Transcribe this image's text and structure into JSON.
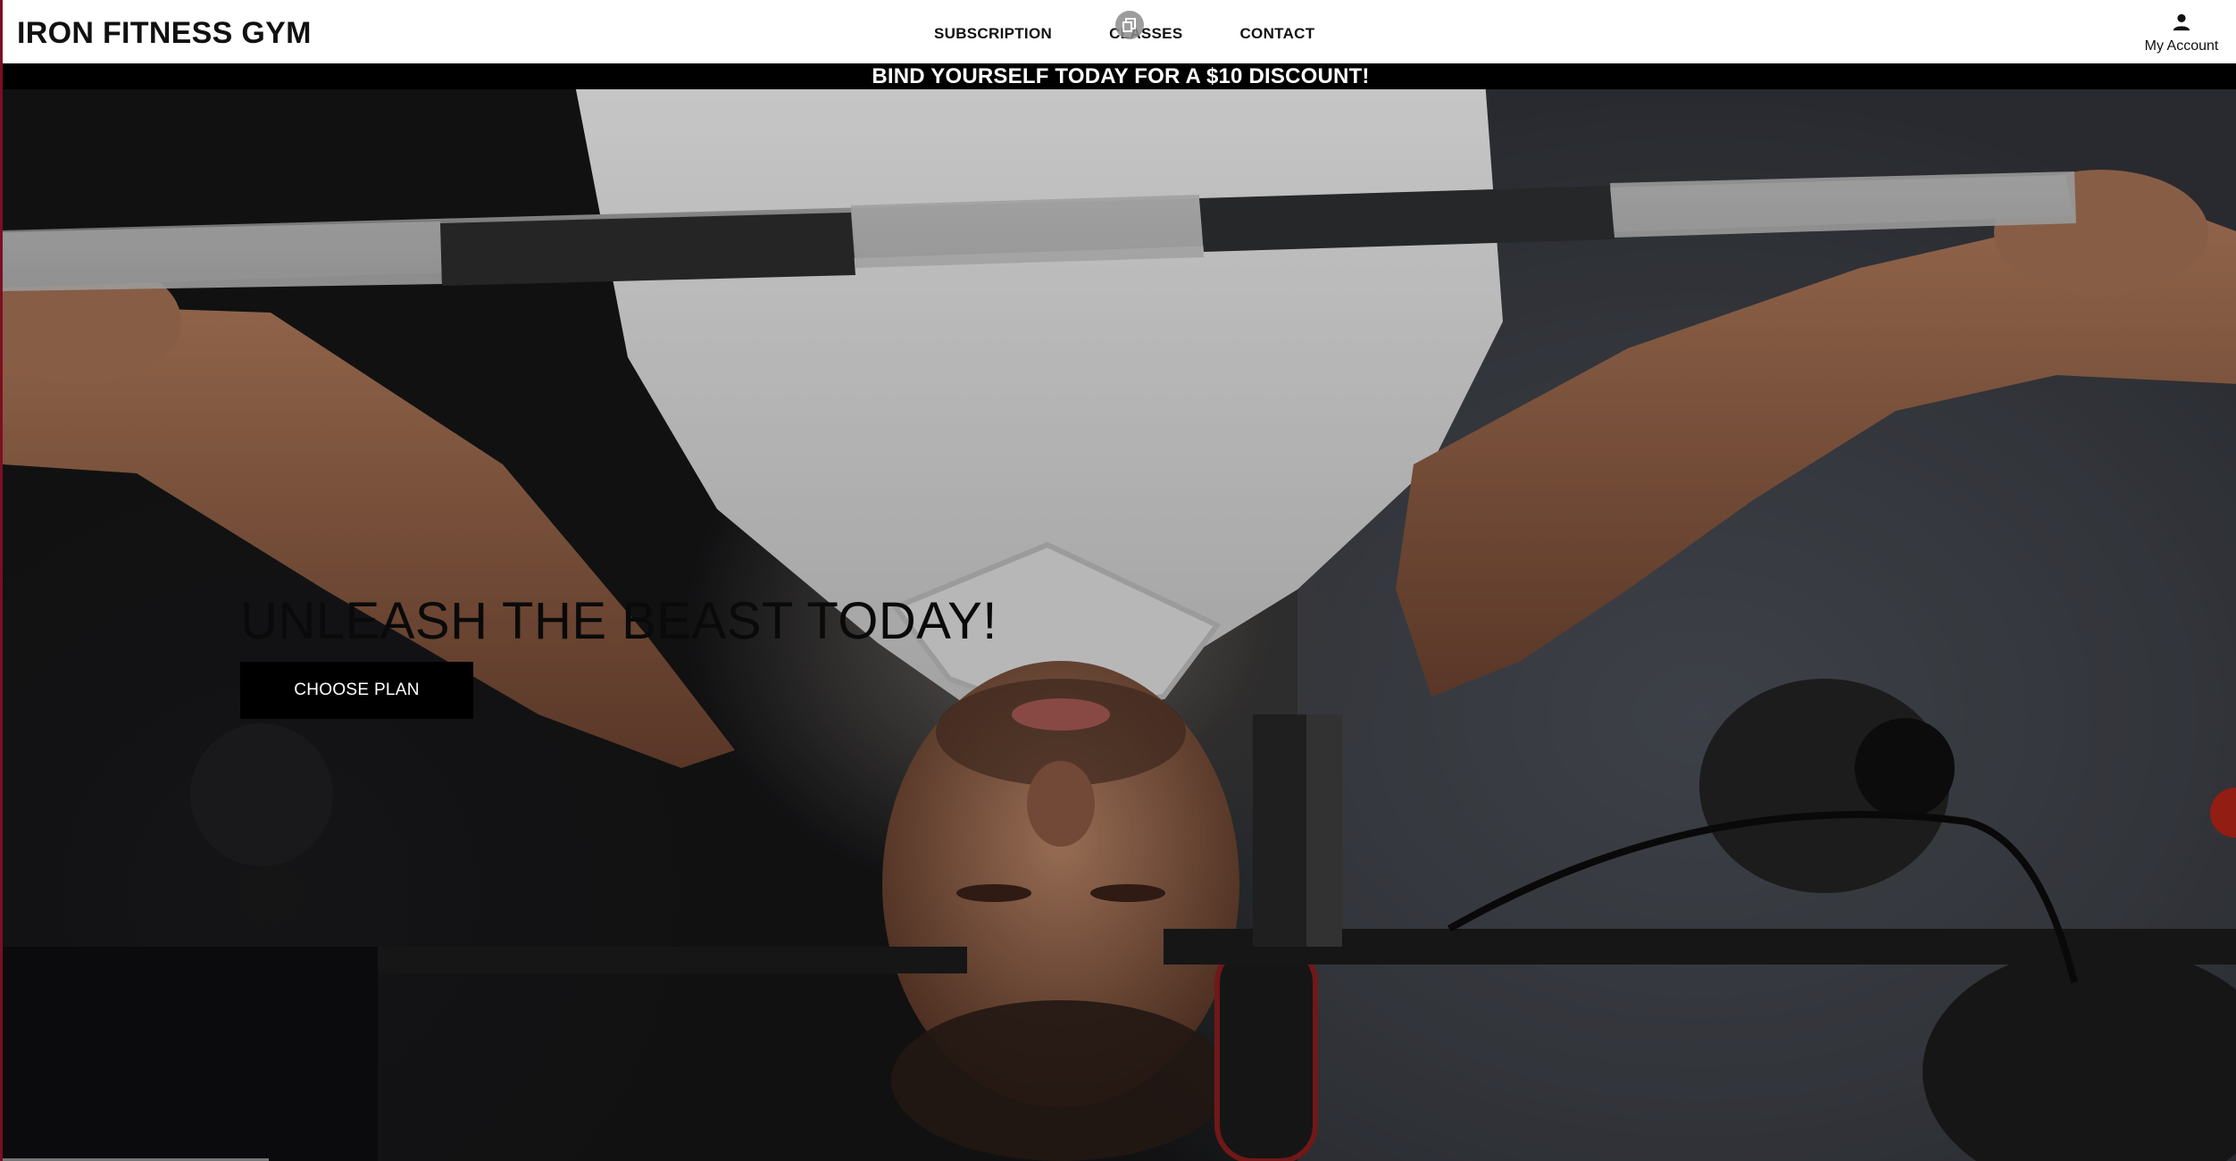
{
  "header": {
    "brand": "IRON FITNESS GYM",
    "nav": {
      "subscription": "SUBSCRIPTION",
      "classes": "CLASSES",
      "contact": "CONTACT"
    },
    "account": {
      "icon": "user-icon",
      "label": "My Account"
    }
  },
  "promo": {
    "text": "BIND YOURSELF TODAY FOR A $10 DISCOUNT!"
  },
  "hero": {
    "title": "UNLEASH THE BEAST TODAY!",
    "cta_label": "CHOOSE PLAN",
    "image": "man-bench-pressing-barbell"
  },
  "colors": {
    "header_bg": "#ffffff",
    "promo_bg": "#000000",
    "cta_bg": "#000000",
    "accent_border": "#7a0f22"
  }
}
